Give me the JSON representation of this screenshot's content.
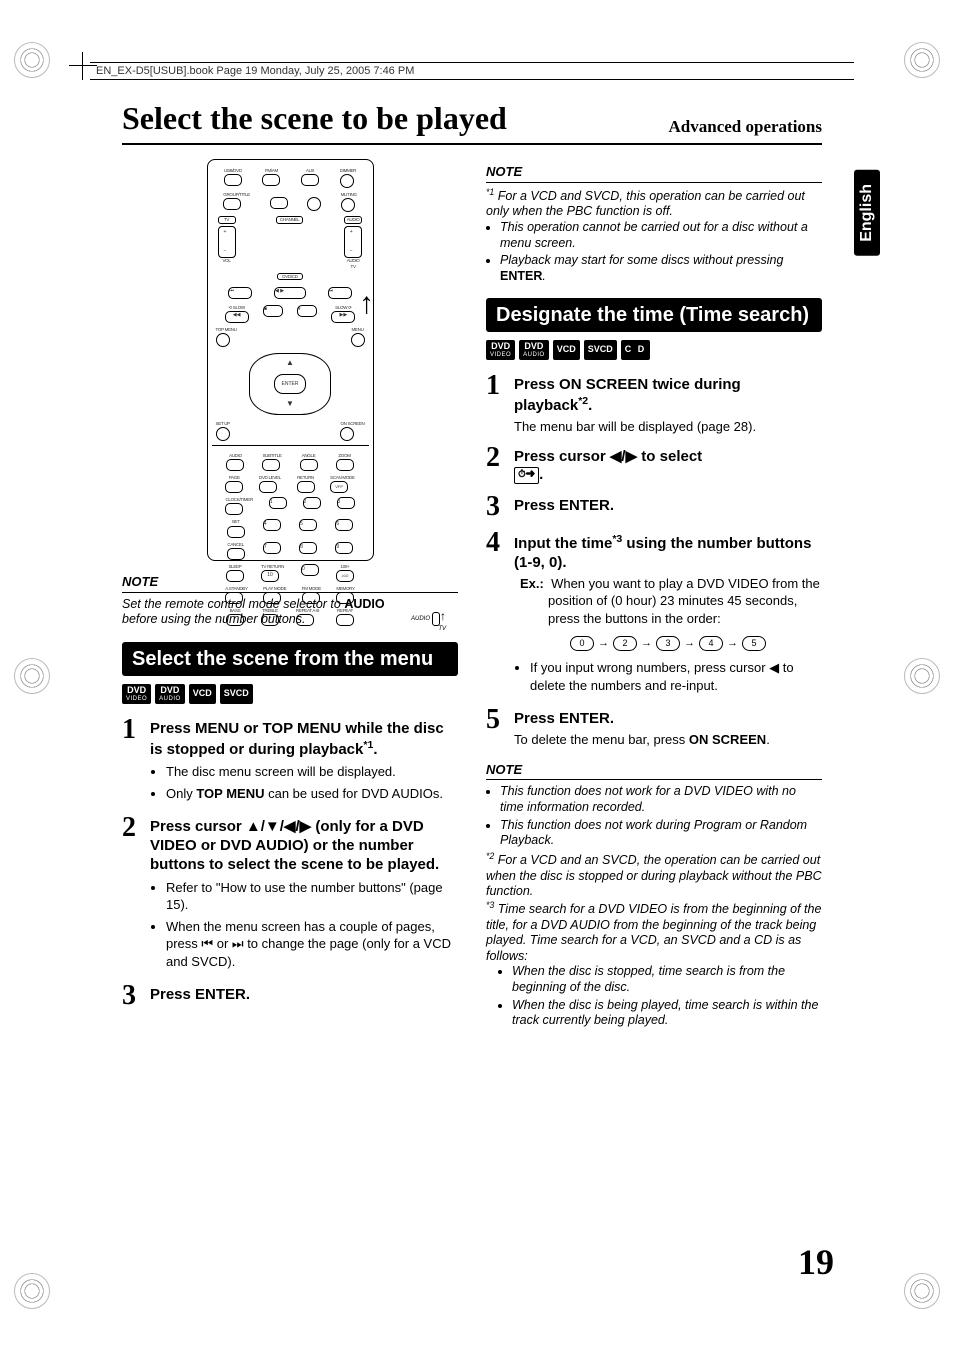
{
  "header": "EN_EX-D5[USUB].book  Page 19  Monday, July 25, 2005  7:46 PM",
  "main_title": "Select the scene to be played",
  "subtitle": "Advanced operations",
  "lang_tab": "English",
  "page_number": "19",
  "remote_labels": {
    "top_row": [
      "USB/DVD",
      "FM/AM",
      "AUX",
      "DIMMER"
    ],
    "row2": [
      "GROUP/TITLE",
      "",
      "",
      "MUTING"
    ],
    "tv": "TV",
    "channel": "CHANNEL",
    "audio": "AUDIO",
    "vol": "VOL",
    "dvdcd": "DVD/CD",
    "slow": "SLOW",
    "slow2": "SLOW",
    "topmenu": "TOP MENU",
    "menu": "MENU",
    "enter": "ENTER",
    "setup": "SET UP",
    "onscreen": "ON SCREEN",
    "row_a": [
      "AUDIO",
      "SUBTITLE",
      "ANGLE",
      "ZOOM"
    ],
    "row_b": [
      "PAGE",
      "DVD LEVEL",
      "RETURN",
      "SCAN MODE"
    ],
    "clocktimer": "CLOCK/TIMER",
    "vfp": "VFP",
    "set": "SET",
    "cancel": "CANCEL",
    "sleep": "SLEEP",
    "tvreturn": "TV RETURN",
    "hundred": "100+",
    "bottom_row": [
      "A.STANDBY",
      "PLAY MODE",
      "FM MODE",
      "MEMORY"
    ],
    "bass": "BASS",
    "treble": "TREBLE",
    "repeat_ab": "REPEAT A-B",
    "repeat": "REPEAT"
  },
  "col1": {
    "note1_hd": "NOTE",
    "note1_txt": "Set the remote control mode selector to ",
    "note1_bold": "AUDIO",
    "note1_txt2": " before using the number buttons.",
    "audio_label": "AUDIO",
    "tv_label": "TV",
    "section1": "Select the scene from the menu",
    "formats1": [
      "DVD VIDEO",
      "DVD AUDIO",
      "VCD",
      "SVCD"
    ],
    "s1": {
      "title": "Press MENU or TOP MENU while the disc is stopped or during playback",
      "sup": "*1",
      "title_end": ".",
      "b1": "The disc menu screen will be displayed.",
      "b2a": "Only ",
      "b2b": "TOP MENU",
      "b2c": " can be used for DVD AUDIOs."
    },
    "s2": {
      "title_a": "Press cursor ",
      "title_b": " (only for a DVD VIDEO or DVD AUDIO) or the number buttons to select the scene to be played.",
      "b1": "Refer to \"How to use the number buttons\" (page 15).",
      "b2": "When the menu screen has a couple of pages, press ⏮ or ⏭ to change the page (only for a VCD and SVCD)."
    },
    "s3": {
      "title": "Press ENTER."
    }
  },
  "col2": {
    "note1_hd": "NOTE",
    "note1_items": [
      {
        "sup": "*1",
        "txt": "For a VCD and SVCD, this operation can be carried out only when the PBC function is off."
      },
      {
        "bullet": true,
        "txt": "This operation cannot be carried out for a disc without a menu screen."
      },
      {
        "bullet": true,
        "txt_a": "Playback may start for some discs without pressing ",
        "bold": "ENTER",
        "txt_b": "."
      }
    ],
    "section2": "Designate the time (Time search)",
    "formats2": [
      "DVD VIDEO",
      "DVD AUDIO",
      "VCD",
      "SVCD",
      "C D"
    ],
    "s1": {
      "title_a": "Press ON SCREEN twice during playback",
      "sup": "*2",
      "title_b": ".",
      "line": "The menu bar will be displayed (page 28)."
    },
    "s2": {
      "title_a": "Press cursor ",
      "title_b": " to select ",
      "icon": "⏱➜",
      "title_c": "."
    },
    "s3": {
      "title": "Press ENTER."
    },
    "s4": {
      "title_a": "Input the time",
      "sup": "*3",
      "title_b": " using the number buttons (1-9, 0).",
      "ex_label": "Ex.:",
      "ex_txt": "When you want to play a DVD VIDEO from the position of (0 hour) 23 minutes 45 seconds, press the buttons in the order:",
      "seq": [
        "0",
        "2",
        "3",
        "4",
        "5"
      ],
      "b1": "If you input wrong numbers, press cursor ◀ to delete the numbers and re-input."
    },
    "s5": {
      "title": "Press ENTER.",
      "line_a": "To delete the menu bar, press ",
      "line_b": "ON SCREEN",
      "line_c": "."
    },
    "note2_hd": "NOTE",
    "note2_items": [
      "This function does not work for a DVD VIDEO with no time information recorded.",
      "This function does not work during Program or Random Playback."
    ],
    "note2_star2": "For a VCD and an SVCD, the operation can be carried out when the disc is stopped or during playback without the PBC function.",
    "note2_star3": "Time search for a DVD VIDEO is from the beginning of the title, for a DVD AUDIO from the beginning of the track being played. Time search for a VCD, an SVCD and a CD is as follows:",
    "note2_sub": [
      "When the disc is stopped, time search is from the beginning of the disc.",
      "When the disc is being played, time search is within the track currently being played."
    ]
  }
}
